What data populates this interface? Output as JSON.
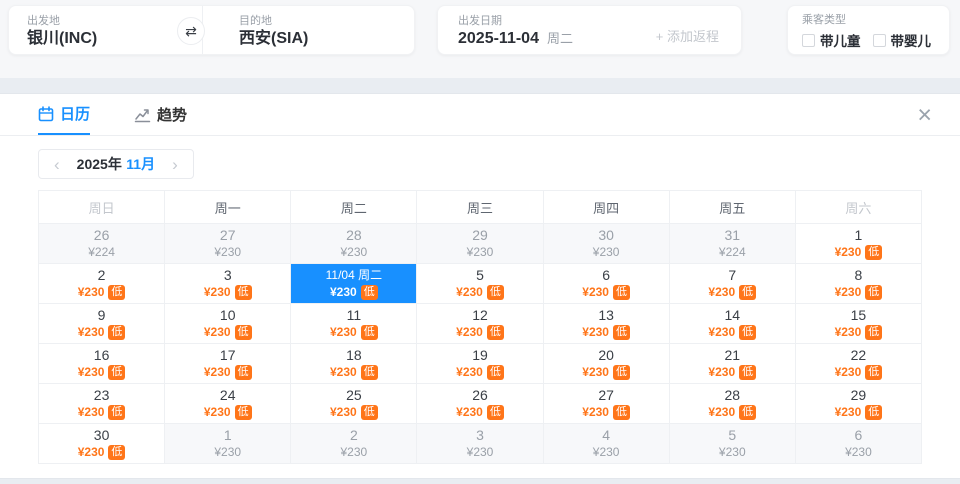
{
  "search_bar": {
    "route": {
      "from_label": "出发地",
      "from_value": "银川(INC)",
      "to_label": "目的地",
      "to_value": "西安(SIA)"
    },
    "date": {
      "label": "出发日期",
      "value": "2025-11-04",
      "weekday": "周二",
      "add_return": "+ 添加返程"
    },
    "passenger": {
      "label": "乘客类型",
      "options": [
        {
          "label": "带儿童",
          "checked": false
        },
        {
          "label": "带婴儿",
          "checked": false
        }
      ]
    }
  },
  "panel": {
    "tabs": {
      "calendar_label": "日历",
      "trend_label": "趋势"
    },
    "month_nav": {
      "prev": "‹",
      "year": "2025年",
      "month": "11月",
      "next": "›"
    },
    "calendar": {
      "weekday_headers": [
        "周日",
        "周一",
        "周二",
        "周三",
        "周四",
        "周五",
        "周六"
      ],
      "low_badge": "低",
      "weeks": [
        [
          {
            "day": "26",
            "price": "¥224",
            "state": "other"
          },
          {
            "day": "27",
            "price": "¥230",
            "state": "other"
          },
          {
            "day": "28",
            "price": "¥230",
            "state": "other"
          },
          {
            "day": "29",
            "price": "¥230",
            "state": "other"
          },
          {
            "day": "30",
            "price": "¥230",
            "state": "other"
          },
          {
            "day": "31",
            "price": "¥224",
            "state": "other"
          },
          {
            "day": "1",
            "price": "¥230",
            "state": "low"
          }
        ],
        [
          {
            "day": "2",
            "price": "¥230",
            "state": "low"
          },
          {
            "day": "3",
            "price": "¥230",
            "state": "low"
          },
          {
            "day": "11/04 周二",
            "price": "¥230",
            "state": "selected"
          },
          {
            "day": "5",
            "price": "¥230",
            "state": "low"
          },
          {
            "day": "6",
            "price": "¥230",
            "state": "low"
          },
          {
            "day": "7",
            "price": "¥230",
            "state": "low"
          },
          {
            "day": "8",
            "price": "¥230",
            "state": "low"
          }
        ],
        [
          {
            "day": "9",
            "price": "¥230",
            "state": "low"
          },
          {
            "day": "10",
            "price": "¥230",
            "state": "low"
          },
          {
            "day": "11",
            "price": "¥230",
            "state": "low"
          },
          {
            "day": "12",
            "price": "¥230",
            "state": "low"
          },
          {
            "day": "13",
            "price": "¥230",
            "state": "low"
          },
          {
            "day": "14",
            "price": "¥230",
            "state": "low"
          },
          {
            "day": "15",
            "price": "¥230",
            "state": "low"
          }
        ],
        [
          {
            "day": "16",
            "price": "¥230",
            "state": "low"
          },
          {
            "day": "17",
            "price": "¥230",
            "state": "low"
          },
          {
            "day": "18",
            "price": "¥230",
            "state": "low"
          },
          {
            "day": "19",
            "price": "¥230",
            "state": "low"
          },
          {
            "day": "20",
            "price": "¥230",
            "state": "low"
          },
          {
            "day": "21",
            "price": "¥230",
            "state": "low"
          },
          {
            "day": "22",
            "price": "¥230",
            "state": "low"
          }
        ],
        [
          {
            "day": "23",
            "price": "¥230",
            "state": "low"
          },
          {
            "day": "24",
            "price": "¥230",
            "state": "low"
          },
          {
            "day": "25",
            "price": "¥230",
            "state": "low"
          },
          {
            "day": "26",
            "price": "¥230",
            "state": "low"
          },
          {
            "day": "27",
            "price": "¥230",
            "state": "low"
          },
          {
            "day": "28",
            "price": "¥230",
            "state": "low"
          },
          {
            "day": "29",
            "price": "¥230",
            "state": "low"
          }
        ],
        [
          {
            "day": "30",
            "price": "¥230",
            "state": "low"
          },
          {
            "day": "1",
            "price": "¥230",
            "state": "other"
          },
          {
            "day": "2",
            "price": "¥230",
            "state": "other"
          },
          {
            "day": "3",
            "price": "¥230",
            "state": "other"
          },
          {
            "day": "4",
            "price": "¥230",
            "state": "other"
          },
          {
            "day": "5",
            "price": "¥230",
            "state": "other"
          },
          {
            "day": "6",
            "price": "¥230",
            "state": "other"
          }
        ]
      ]
    }
  },
  "icons": {
    "swap": "⇄",
    "close": "×"
  },
  "colors": {
    "accent_blue": "#1890ff",
    "price_orange": "#ff7519",
    "selected_bg": "#1890ff"
  }
}
